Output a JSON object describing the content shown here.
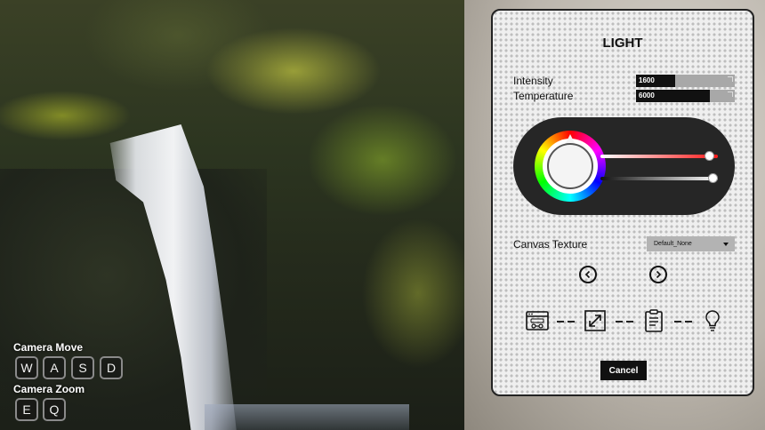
{
  "hints": {
    "camera_move_label": "Camera Move",
    "move_keys": [
      "W",
      "A",
      "S",
      "D"
    ],
    "camera_zoom_label": "Camera Zoom",
    "zoom_keys": [
      "E",
      "Q"
    ]
  },
  "panel": {
    "title": "LIGHT",
    "intensity": {
      "label": "Intensity",
      "value": "1600",
      "fill": 0.4
    },
    "temperature": {
      "label": "Temperature",
      "value": "6000",
      "fill": 0.75
    },
    "color_picker": {
      "hue_wheel": true,
      "saturation": 0.97,
      "brightness": 1.0
    },
    "canvas_texture": {
      "label": "Canvas Texture",
      "selected": "Default_None"
    },
    "steps": [
      "url-icon",
      "resize-icon",
      "clipboard-icon",
      "lightbulb-icon"
    ],
    "cancel_label": "Cancel"
  },
  "colors": {
    "panel_bg": "#efefef",
    "accent_dark": "#111111",
    "field_gray": "#a8a8a8"
  }
}
